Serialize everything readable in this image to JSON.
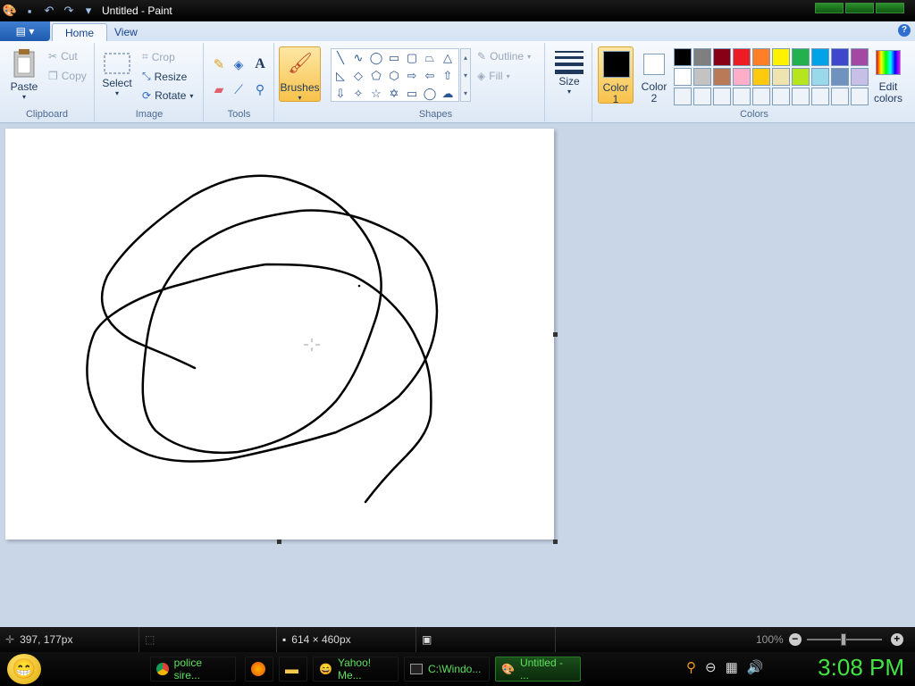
{
  "titlebar": {
    "title": "Untitled - Paint"
  },
  "tabs": [
    {
      "label": "Home"
    },
    {
      "label": "View"
    }
  ],
  "help": {
    "label": "?"
  },
  "clipboard": {
    "paste": "Paste",
    "cut": "Cut",
    "copy": "Copy",
    "group": "Clipboard"
  },
  "image": {
    "select": "Select",
    "crop": "Crop",
    "resize": "Resize",
    "rotate": "Rotate",
    "group": "Image"
  },
  "tools": {
    "group": "Tools",
    "text_tool": "A"
  },
  "brushes": {
    "label": "Brushes"
  },
  "shapes": {
    "group": "Shapes",
    "outline": "Outline",
    "fill": "Fill"
  },
  "size": {
    "label": "Size"
  },
  "colors": {
    "color1_label": "Color",
    "color1_num": "1",
    "color2_label": "Color",
    "color2_num": "2",
    "edit_label": "Edit",
    "edit_label2": "colors",
    "group": "Colors",
    "color1": "#000000",
    "color2": "#ffffff",
    "palette_row1": [
      "#000000",
      "#7f7f7f",
      "#880015",
      "#ed1c24",
      "#ff7f27",
      "#fff200",
      "#22b14c",
      "#00a2e8",
      "#3f48cc",
      "#a349a4"
    ],
    "palette_row2": [
      "#ffffff",
      "#c3c3c3",
      "#b97a57",
      "#ffaec9",
      "#ffc90e",
      "#efe4b0",
      "#b5e61d",
      "#99d9ea",
      "#7092be",
      "#c8bfe7"
    ]
  },
  "status": {
    "coords": "397, 177px",
    "canvas_size": "614 × 460px",
    "zoom": "100%"
  },
  "taskbar": {
    "items": [
      {
        "label": "police sire..."
      },
      {
        "label": ""
      },
      {
        "label": ""
      },
      {
        "label": "Yahoo! Me..."
      },
      {
        "label": "C:\\Windo..."
      },
      {
        "label": "Untitled - ..."
      }
    ],
    "clock": "3:08 PM"
  }
}
